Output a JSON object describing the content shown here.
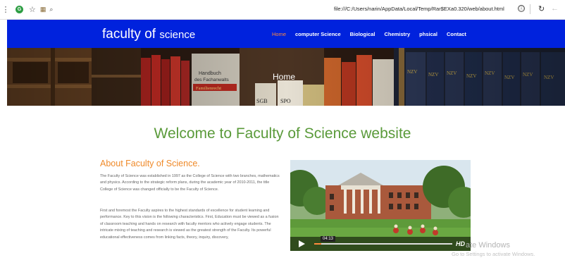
{
  "browser": {
    "url": "file:///C:/Users/narin/AppData/Local/Temp/Rar$EXa0.320/web/about.html",
    "info_glyph": "ⓘ",
    "reload_glyph": "↻",
    "back_glyph": "←"
  },
  "site": {
    "brand_main": "faculty of",
    "brand_small": "science",
    "nav": [
      {
        "label": "Home",
        "active": true
      },
      {
        "label": "computer Science"
      },
      {
        "label": "Biological"
      },
      {
        "label": "Chemistry"
      },
      {
        "label": "phsical"
      },
      {
        "label": "Contact"
      }
    ],
    "nav_colors": {
      "bar": "#0022dd",
      "active": "#ff8a3d",
      "link": "#ffffff"
    }
  },
  "hero": {
    "title": "Home",
    "book_labels": [
      "Handbuch des Fachanwalts",
      "Familienrecht",
      "SGB",
      "SPO",
      "NZV"
    ]
  },
  "main": {
    "welcome": "Welcome to Faculty of Science website",
    "welcome_color": "#5a9a3a",
    "about_title": "About Faculty of Science.",
    "about_color": "#ef8a2a",
    "paragraph1": "The Faculty of Science was established in 1997 as the College of Science with two branches, mathematics and physics. According to the strategic reform plans, during the academic year of 2010-2011, the title College of Science was changed officially to be the Faculty of Science.",
    "paragraph2": "First and foremost the Faculty aspires to the highest standards of excellence for student learning and performance. Key to this vision is the following characteristics. First, Education must be viewed as a fusion of classroom teaching and hands on research with faculty mentors who actively engage students. The intricate mixing of teaching and research is viewed as the greatest strength of the Faculty. Its powerful educational effectiveness comes from linking facts, theory, inquiry, discovery,"
  },
  "video": {
    "time": "04:13",
    "hd_label": "HD",
    "progress": 0.05
  },
  "watermark": {
    "line1": "ate Windows",
    "line2": "Go to Settings to activate Windows."
  }
}
